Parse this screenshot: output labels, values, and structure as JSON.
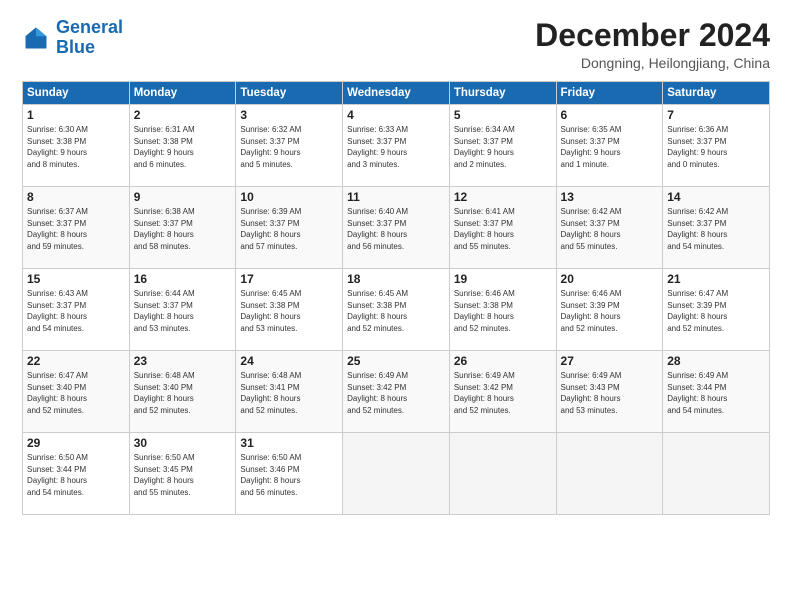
{
  "logo": {
    "line1": "General",
    "line2": "Blue"
  },
  "title": "December 2024",
  "location": "Dongning, Heilongjiang, China",
  "weekdays": [
    "Sunday",
    "Monday",
    "Tuesday",
    "Wednesday",
    "Thursday",
    "Friday",
    "Saturday"
  ],
  "weeks": [
    [
      {
        "day": "1",
        "info": "Sunrise: 6:30 AM\nSunset: 3:38 PM\nDaylight: 9 hours\nand 8 minutes."
      },
      {
        "day": "2",
        "info": "Sunrise: 6:31 AM\nSunset: 3:38 PM\nDaylight: 9 hours\nand 6 minutes."
      },
      {
        "day": "3",
        "info": "Sunrise: 6:32 AM\nSunset: 3:37 PM\nDaylight: 9 hours\nand 5 minutes."
      },
      {
        "day": "4",
        "info": "Sunrise: 6:33 AM\nSunset: 3:37 PM\nDaylight: 9 hours\nand 3 minutes."
      },
      {
        "day": "5",
        "info": "Sunrise: 6:34 AM\nSunset: 3:37 PM\nDaylight: 9 hours\nand 2 minutes."
      },
      {
        "day": "6",
        "info": "Sunrise: 6:35 AM\nSunset: 3:37 PM\nDaylight: 9 hours\nand 1 minute."
      },
      {
        "day": "7",
        "info": "Sunrise: 6:36 AM\nSunset: 3:37 PM\nDaylight: 9 hours\nand 0 minutes."
      }
    ],
    [
      {
        "day": "8",
        "info": "Sunrise: 6:37 AM\nSunset: 3:37 PM\nDaylight: 8 hours\nand 59 minutes."
      },
      {
        "day": "9",
        "info": "Sunrise: 6:38 AM\nSunset: 3:37 PM\nDaylight: 8 hours\nand 58 minutes."
      },
      {
        "day": "10",
        "info": "Sunrise: 6:39 AM\nSunset: 3:37 PM\nDaylight: 8 hours\nand 57 minutes."
      },
      {
        "day": "11",
        "info": "Sunrise: 6:40 AM\nSunset: 3:37 PM\nDaylight: 8 hours\nand 56 minutes."
      },
      {
        "day": "12",
        "info": "Sunrise: 6:41 AM\nSunset: 3:37 PM\nDaylight: 8 hours\nand 55 minutes."
      },
      {
        "day": "13",
        "info": "Sunrise: 6:42 AM\nSunset: 3:37 PM\nDaylight: 8 hours\nand 55 minutes."
      },
      {
        "day": "14",
        "info": "Sunrise: 6:42 AM\nSunset: 3:37 PM\nDaylight: 8 hours\nand 54 minutes."
      }
    ],
    [
      {
        "day": "15",
        "info": "Sunrise: 6:43 AM\nSunset: 3:37 PM\nDaylight: 8 hours\nand 54 minutes."
      },
      {
        "day": "16",
        "info": "Sunrise: 6:44 AM\nSunset: 3:37 PM\nDaylight: 8 hours\nand 53 minutes."
      },
      {
        "day": "17",
        "info": "Sunrise: 6:45 AM\nSunset: 3:38 PM\nDaylight: 8 hours\nand 53 minutes."
      },
      {
        "day": "18",
        "info": "Sunrise: 6:45 AM\nSunset: 3:38 PM\nDaylight: 8 hours\nand 52 minutes."
      },
      {
        "day": "19",
        "info": "Sunrise: 6:46 AM\nSunset: 3:38 PM\nDaylight: 8 hours\nand 52 minutes."
      },
      {
        "day": "20",
        "info": "Sunrise: 6:46 AM\nSunset: 3:39 PM\nDaylight: 8 hours\nand 52 minutes."
      },
      {
        "day": "21",
        "info": "Sunrise: 6:47 AM\nSunset: 3:39 PM\nDaylight: 8 hours\nand 52 minutes."
      }
    ],
    [
      {
        "day": "22",
        "info": "Sunrise: 6:47 AM\nSunset: 3:40 PM\nDaylight: 8 hours\nand 52 minutes."
      },
      {
        "day": "23",
        "info": "Sunrise: 6:48 AM\nSunset: 3:40 PM\nDaylight: 8 hours\nand 52 minutes."
      },
      {
        "day": "24",
        "info": "Sunrise: 6:48 AM\nSunset: 3:41 PM\nDaylight: 8 hours\nand 52 minutes."
      },
      {
        "day": "25",
        "info": "Sunrise: 6:49 AM\nSunset: 3:42 PM\nDaylight: 8 hours\nand 52 minutes."
      },
      {
        "day": "26",
        "info": "Sunrise: 6:49 AM\nSunset: 3:42 PM\nDaylight: 8 hours\nand 52 minutes."
      },
      {
        "day": "27",
        "info": "Sunrise: 6:49 AM\nSunset: 3:43 PM\nDaylight: 8 hours\nand 53 minutes."
      },
      {
        "day": "28",
        "info": "Sunrise: 6:49 AM\nSunset: 3:44 PM\nDaylight: 8 hours\nand 54 minutes."
      }
    ],
    [
      {
        "day": "29",
        "info": "Sunrise: 6:50 AM\nSunset: 3:44 PM\nDaylight: 8 hours\nand 54 minutes."
      },
      {
        "day": "30",
        "info": "Sunrise: 6:50 AM\nSunset: 3:45 PM\nDaylight: 8 hours\nand 55 minutes."
      },
      {
        "day": "31",
        "info": "Sunrise: 6:50 AM\nSunset: 3:46 PM\nDaylight: 8 hours\nand 56 minutes."
      },
      null,
      null,
      null,
      null
    ]
  ]
}
